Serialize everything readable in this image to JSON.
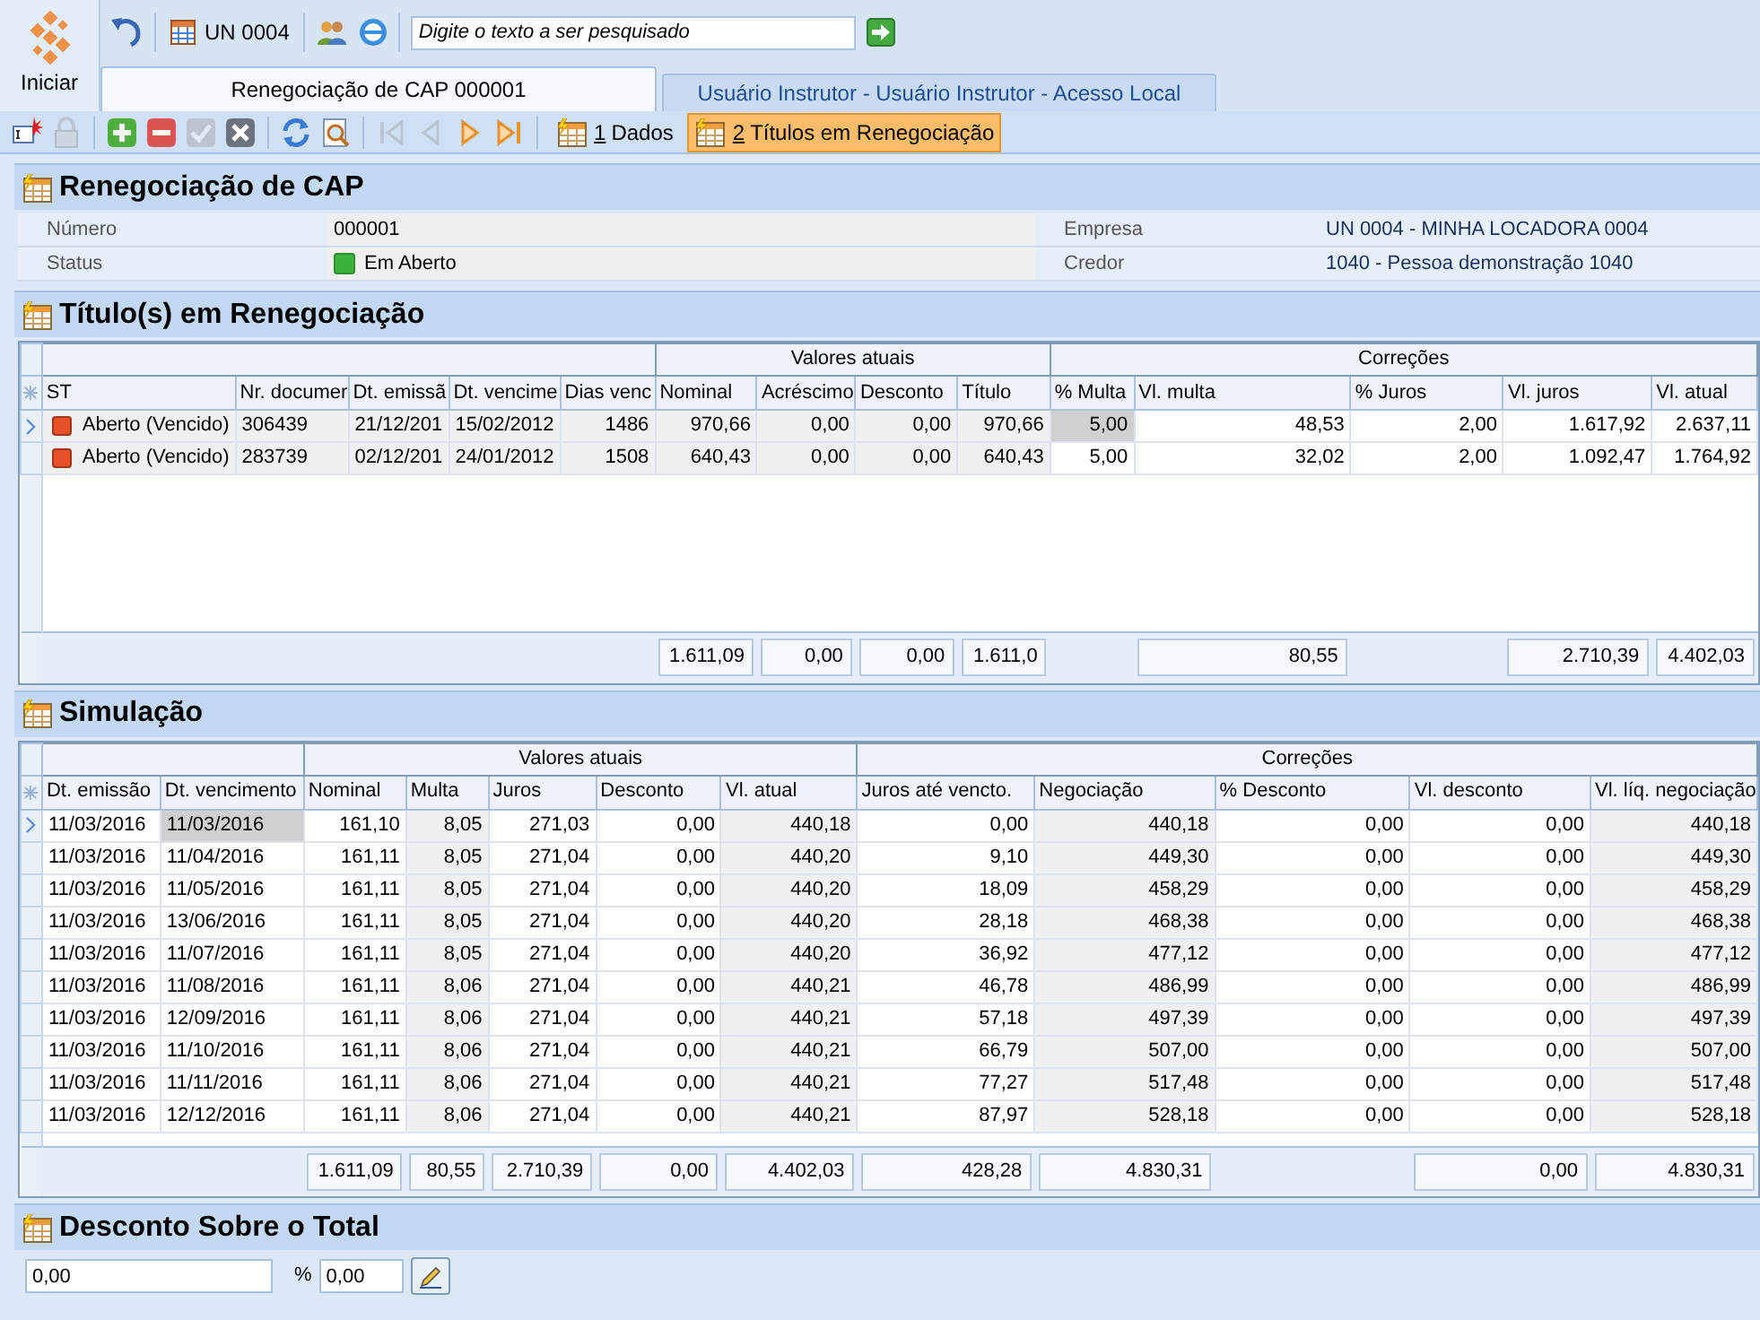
{
  "app": {
    "start_label": "Iniciar"
  },
  "quick_bar": {
    "unit": "UN 0004",
    "search": {
      "placeholder": "Digite o texto a ser pesquisado"
    }
  },
  "tabs": [
    {
      "label": "Renegociação de CAP 000001",
      "selected": true
    },
    {
      "label": "Usuário Instrutor - Usuário Instrutor - Acesso Local",
      "selected": false
    }
  ],
  "toolbar": {
    "icons": [
      {
        "disabled": false
      },
      {
        "disabled": true
      },
      {
        "disabled": false
      },
      {
        "disabled": false
      },
      {
        "disabled": true
      },
      {
        "disabled": false
      },
      {
        "disabled": false
      },
      {
        "disabled": false
      },
      {
        "disabled": true
      },
      {
        "disabled": true
      },
      {
        "disabled": false
      },
      {
        "disabled": false
      }
    ],
    "views": [
      {
        "number": "1",
        "label": "Dados",
        "selected": false
      },
      {
        "number": "2",
        "label": "Títulos em Renegociação",
        "selected": true
      }
    ]
  },
  "header": {
    "title": "Renegociação de CAP",
    "fields": [
      {
        "label": "Número",
        "value": "000001"
      },
      {
        "label": "Empresa",
        "value": "UN 0004 - MINHA LOCADORA 0004"
      },
      {
        "label": "Status",
        "value": "Em Aberto",
        "color": "#3cb43c"
      },
      {
        "label": "Credor",
        "value": "1040 - Pessoa demonstração 1040"
      }
    ]
  },
  "titles": {
    "title": "Título(s) em Renegociação",
    "column_groups": [
      {
        "columns": [
          {
            "label": "ST",
            "kind": "status",
            "readonly": true,
            "current": false
          },
          {
            "label": "Nr. documer",
            "kind": "text",
            "readonly": true,
            "current": false
          },
          {
            "label": "Dt. emissã",
            "kind": "text",
            "readonly": true,
            "current": false
          },
          {
            "label": "Dt. vencime",
            "kind": "text",
            "readonly": true,
            "current": false
          },
          {
            "label": "Dias venc",
            "kind": "number",
            "readonly": true,
            "current": false
          }
        ]
      },
      {
        "label": "Valores atuais",
        "columns": [
          {
            "label": "Nominal",
            "kind": "number",
            "readonly": true,
            "current": false,
            "total": "1.611,09"
          },
          {
            "label": "Acréscimo",
            "kind": "number",
            "readonly": true,
            "current": false,
            "total": "0,00"
          },
          {
            "label": "Desconto",
            "kind": "number",
            "readonly": true,
            "current": false,
            "total": "0,00"
          },
          {
            "label": "Título",
            "kind": "number",
            "readonly": true,
            "current": false,
            "total": "1.611,0"
          }
        ]
      },
      {
        "label": "Correções",
        "columns": [
          {
            "label": "% Multa",
            "kind": "number",
            "readonly": false,
            "current": true
          },
          {
            "label": "Vl. multa",
            "kind": "number",
            "readonly": false,
            "current": false,
            "total": "80,55"
          },
          {
            "label": "% Juros",
            "kind": "number",
            "readonly": false,
            "current": false
          },
          {
            "label": "Vl. juros",
            "kind": "number",
            "readonly": false,
            "current": false,
            "total": "2.710,39"
          },
          {
            "label": "Vl. atual",
            "kind": "number",
            "readonly": false,
            "current": false,
            "total": "4.402,03"
          }
        ]
      }
    ],
    "rows": [
      {
        "selected": true,
        "color": "#e8502a",
        "cells": [
          "Aberto (Vencido)",
          "306439",
          "21/12/201",
          "15/02/2012",
          "1486",
          "970,66",
          "0,00",
          "0,00",
          "970,66",
          "5,00",
          "48,53",
          "2,00",
          "1.617,92",
          "2.637,11"
        ]
      },
      {
        "selected": false,
        "color": "#e8502a",
        "cells": [
          "Aberto (Vencido)",
          "283739",
          "02/12/201",
          "24/01/2012",
          "1508",
          "640,43",
          "0,00",
          "0,00",
          "640,43",
          "5,00",
          "32,02",
          "2,00",
          "1.092,47",
          "1.764,92"
        ]
      }
    ]
  },
  "simulation": {
    "title": "Simulação",
    "column_groups": [
      {
        "columns": [
          {
            "label": "Dt. emissão",
            "kind": "text",
            "readonly": false,
            "current": false
          },
          {
            "label": "Dt. vencimento",
            "kind": "text",
            "readonly": false,
            "current": true
          }
        ]
      },
      {
        "label": "Valores atuais",
        "columns": [
          {
            "label": "Nominal",
            "kind": "number",
            "readonly": false,
            "current": false,
            "total": "1.611,09"
          },
          {
            "label": "Multa",
            "kind": "number",
            "readonly": true,
            "current": false,
            "total": "80,55"
          },
          {
            "label": "Juros",
            "kind": "number",
            "readonly": false,
            "current": false,
            "total": "2.710,39"
          },
          {
            "label": "Desconto",
            "kind": "number",
            "readonly": false,
            "current": false,
            "total": "0,00"
          },
          {
            "label": "Vl. atual",
            "kind": "number",
            "readonly": true,
            "current": false,
            "total": "4.402,03"
          }
        ]
      },
      {
        "label": "Correções",
        "columns": [
          {
            "label": "Juros até vencto.",
            "kind": "number",
            "readonly": false,
            "current": false,
            "total": "428,28"
          },
          {
            "label": "Negociação",
            "kind": "number",
            "readonly": true,
            "current": false,
            "total": "4.830,31"
          },
          {
            "label": "% Desconto",
            "kind": "number",
            "readonly": false,
            "current": false
          },
          {
            "label": "Vl. desconto",
            "kind": "number",
            "readonly": false,
            "current": false,
            "total": "0,00"
          },
          {
            "label": "Vl. líq. negociação",
            "kind": "number",
            "readonly": true,
            "current": false,
            "total": "4.830,31"
          }
        ]
      }
    ],
    "rows": [
      {
        "selected": true,
        "cells": [
          "11/03/2016",
          "11/03/2016",
          "161,10",
          "8,05",
          "271,03",
          "0,00",
          "440,18",
          "0,00",
          "440,18",
          "0,00",
          "0,00",
          "440,18"
        ]
      },
      {
        "selected": false,
        "cells": [
          "11/03/2016",
          "11/04/2016",
          "161,11",
          "8,05",
          "271,04",
          "0,00",
          "440,20",
          "9,10",
          "449,30",
          "0,00",
          "0,00",
          "449,30"
        ]
      },
      {
        "selected": false,
        "cells": [
          "11/03/2016",
          "11/05/2016",
          "161,11",
          "8,05",
          "271,04",
          "0,00",
          "440,20",
          "18,09",
          "458,29",
          "0,00",
          "0,00",
          "458,29"
        ]
      },
      {
        "selected": false,
        "cells": [
          "11/03/2016",
          "13/06/2016",
          "161,11",
          "8,05",
          "271,04",
          "0,00",
          "440,20",
          "28,18",
          "468,38",
          "0,00",
          "0,00",
          "468,38"
        ]
      },
      {
        "selected": false,
        "cells": [
          "11/03/2016",
          "11/07/2016",
          "161,11",
          "8,05",
          "271,04",
          "0,00",
          "440,20",
          "36,92",
          "477,12",
          "0,00",
          "0,00",
          "477,12"
        ]
      },
      {
        "selected": false,
        "cells": [
          "11/03/2016",
          "11/08/2016",
          "161,11",
          "8,06",
          "271,04",
          "0,00",
          "440,21",
          "46,78",
          "486,99",
          "0,00",
          "0,00",
          "486,99"
        ]
      },
      {
        "selected": false,
        "cells": [
          "11/03/2016",
          "12/09/2016",
          "161,11",
          "8,06",
          "271,04",
          "0,00",
          "440,21",
          "57,18",
          "497,39",
          "0,00",
          "0,00",
          "497,39"
        ]
      },
      {
        "selected": false,
        "cells": [
          "11/03/2016",
          "11/10/2016",
          "161,11",
          "8,06",
          "271,04",
          "0,00",
          "440,21",
          "66,79",
          "507,00",
          "0,00",
          "0,00",
          "507,00"
        ]
      },
      {
        "selected": false,
        "cells": [
          "11/03/2016",
          "11/11/2016",
          "161,11",
          "8,06",
          "271,04",
          "0,00",
          "440,21",
          "77,27",
          "517,48",
          "0,00",
          "0,00",
          "517,48"
        ]
      },
      {
        "selected": false,
        "cells": [
          "11/03/2016",
          "12/12/2016",
          "161,11",
          "8,06",
          "271,04",
          "0,00",
          "440,21",
          "87,97",
          "528,18",
          "0,00",
          "0,00",
          "528,18"
        ]
      }
    ]
  },
  "discount": {
    "title": "Desconto Sobre o Total",
    "value": "0,00",
    "percent_sign": "%",
    "percent": "0,00"
  }
}
